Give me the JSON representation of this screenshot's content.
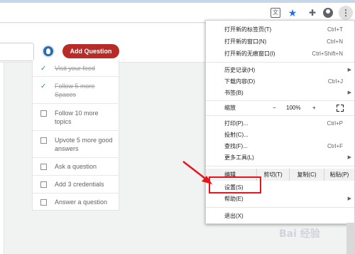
{
  "toolbar": {
    "icons": [
      "translate-icon",
      "bookmark-star-icon",
      "extensions-icon",
      "account-icon",
      "menu-kebab-icon"
    ],
    "star_color": "#1a73e8"
  },
  "header": {
    "add_question_label": "Add Question",
    "accent": "#b92b27"
  },
  "checklist": {
    "items": [
      {
        "label": "Visit your feed",
        "done": true
      },
      {
        "label": "Follow 5 more Spaces",
        "done": true
      },
      {
        "label": "Follow 10 more topics",
        "done": false
      },
      {
        "label": "Upvote 5 more good answers",
        "done": false
      },
      {
        "label": "Ask a question",
        "done": false
      },
      {
        "label": "Add 3 credentials",
        "done": false
      },
      {
        "label": "Answer a question",
        "done": false
      }
    ]
  },
  "menu": {
    "new_tab": {
      "label": "打开新的标签页(T)",
      "shortcut": "Ctrl+T"
    },
    "new_window": {
      "label": "打开新的窗口(N)",
      "shortcut": "Ctrl+N"
    },
    "incognito": {
      "label": "打开新的无痕窗口(I)",
      "shortcut": "Ctrl+Shift+N"
    },
    "history": {
      "label": "历史记录(H)"
    },
    "downloads": {
      "label": "下载内容(D)",
      "shortcut": "Ctrl+J"
    },
    "bookmarks": {
      "label": "书签(B)"
    },
    "zoom": {
      "label": "缩放",
      "minus": "−",
      "value": "100%",
      "plus": "+"
    },
    "print": {
      "label": "打印(P)...",
      "shortcut": "Ctrl+P"
    },
    "cast": {
      "label": "投射(C)..."
    },
    "find": {
      "label": "查找(F)...",
      "shortcut": "Ctrl+F"
    },
    "more_tools": {
      "label": "更多工具(L)"
    },
    "edit": {
      "label": "编辑",
      "cut": "剪切(T)",
      "copy": "复制(C)",
      "paste": "粘贴(P)"
    },
    "settings": {
      "label": "设置(S)"
    },
    "help": {
      "label": "帮助(E)"
    },
    "exit": {
      "label": "退出(X)"
    }
  },
  "annotation": {
    "highlight_color": "#e8141c"
  },
  "watermark": {
    "text": "Bai 经验"
  }
}
